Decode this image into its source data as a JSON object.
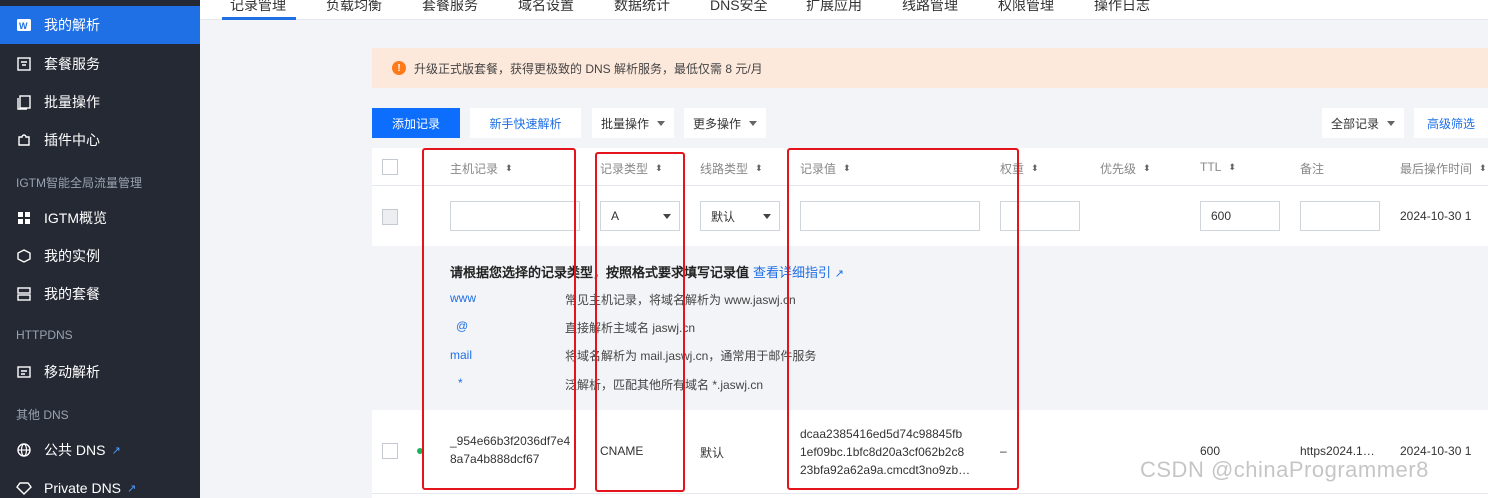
{
  "sidebar": {
    "items": [
      {
        "label": "我的解析",
        "icon": "domain-w-icon"
      },
      {
        "label": "套餐服务",
        "icon": "package-icon"
      },
      {
        "label": "批量操作",
        "icon": "batch-icon"
      },
      {
        "label": "插件中心",
        "icon": "plugin-icon"
      },
      {
        "label": "IGTM概览",
        "icon": "grid-icon"
      },
      {
        "label": "我的实例",
        "icon": "instance-icon"
      },
      {
        "label": "我的套餐",
        "icon": "plan-icon"
      },
      {
        "label": "移动解析",
        "icon": "mobile-dns-icon"
      },
      {
        "label": "公共 DNS",
        "icon": "globe-icon"
      },
      {
        "label": "Private DNS",
        "icon": "diamond-icon"
      }
    ],
    "groups": [
      "IGTM智能全局流量管理",
      "HTTPDNS",
      "其他 DNS"
    ],
    "active_color": "#1f6fe5"
  },
  "tabs": [
    "记录管理",
    "负载均衡",
    "套餐服务",
    "域名设置",
    "数据统计",
    "DNS安全",
    "扩展应用",
    "线路管理",
    "权限管理",
    "操作日志"
  ],
  "banner": {
    "text": "升级正式版套餐，获得更极致的 DNS 解析服务，最低仅需 8 元/月",
    "icon": "warning-icon",
    "color": "#ff7a1a"
  },
  "toolbar": {
    "add": "添加记录",
    "quick": "新手快速解析",
    "batch": "批量操作",
    "more": "更多操作",
    "all_records": "全部记录",
    "advanced": "高级筛选"
  },
  "table": {
    "headers": [
      "主机记录",
      "记录类型",
      "线路类型",
      "记录值",
      "权重",
      "优先级",
      "TTL",
      "备注",
      "最后操作时间"
    ],
    "edit_row": {
      "host": "",
      "type": "A",
      "line": "默认",
      "value": "",
      "weight": "",
      "ttl": "600",
      "remark": "",
      "time": "2024-10-30 1"
    },
    "guide": {
      "title": "请根据您选择的记录类型，按照格式要求填写记录值",
      "link": "查看详细指引",
      "items": [
        {
          "key": "www",
          "desc": "常见主机记录，将域名解析为 www.jaswj.cn"
        },
        {
          "key": "@",
          "desc": "直接解析主域名 jaswj.cn"
        },
        {
          "key": "mail",
          "desc": "将域名解析为 mail.jaswj.cn，通常用于邮件服务"
        },
        {
          "key": "*",
          "desc": "泛解析，匹配其他所有域名 *.jaswj.cn"
        }
      ]
    },
    "record": {
      "host_line1": "_954e66b3f2036df7e4",
      "host_line2": "8a7a4b888dcf67",
      "type": "CNAME",
      "line": "默认",
      "value_line1": "dcaa2385416ed5d74c98845fb",
      "value_line2": "1ef09bc.1bfc8d20a3cf062b2c8",
      "value_line3": "23bfa92a62a9a.cmcdt3no9zb…",
      "weight": "–",
      "ttl": "600",
      "remark": "https2024.1…",
      "time": "2024-10-30 1",
      "status_color": "#18b45a"
    }
  },
  "watermark": "CSDN @chinaProgrammer8",
  "annotation_color": "#e5131b"
}
